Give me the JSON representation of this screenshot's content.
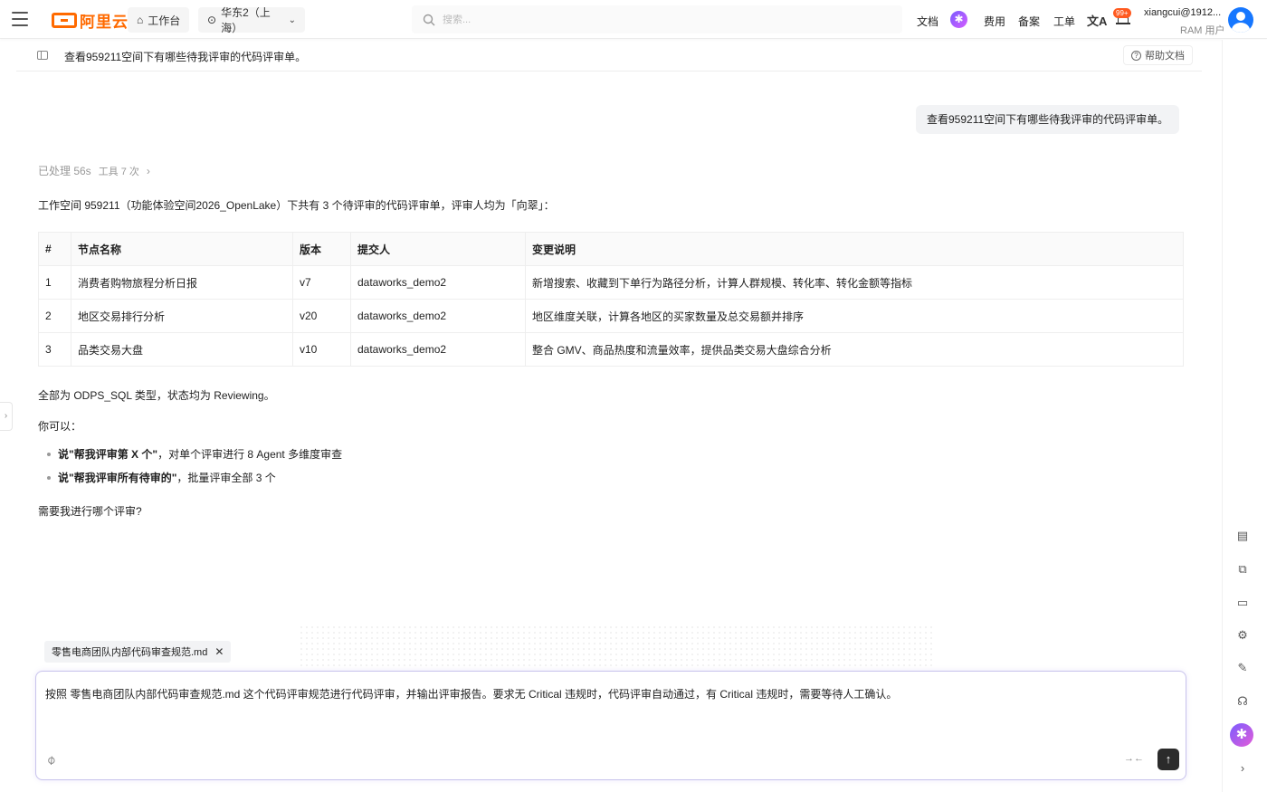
{
  "topbar": {
    "logo_text": "阿里云",
    "workbench": "工作台",
    "region": "华东2（上海）",
    "search_placeholder": "搜索...",
    "links": {
      "docs": "文档",
      "billing": "费用",
      "icp": "备案",
      "tickets": "工单"
    },
    "notification_badge": "99+",
    "user_name": "xiangcui@1912...",
    "user_role": "RAM 用户",
    "accent_color": "#ff6a00"
  },
  "subheader": {
    "title": "查看959211空间下有哪些待我评审的代码评审单。",
    "help": "帮助文档"
  },
  "chat": {
    "user_message": "查看959211空间下有哪些待我评审的代码评审单。",
    "processed": "已处理 56s",
    "tools": "工具 7 次",
    "summary": "工作空间 959211（功能体验空间2026_OpenLake）下共有 3 个待评审的代码评审单，评审人均为「向翠」：",
    "table": {
      "headers": [
        "#",
        "节点名称",
        "版本",
        "提交人",
        "变更说明"
      ],
      "rows": [
        [
          "1",
          "消费者购物旅程分析日报",
          "v7",
          "dataworks_demo2",
          "新增搜索、收藏到下单行为路径分析，计算人群规模、转化率、转化金额等指标"
        ],
        [
          "2",
          "地区交易排行分析",
          "v20",
          "dataworks_demo2",
          "地区维度关联，计算各地区的买家数量及总交易额并排序"
        ],
        [
          "3",
          "品类交易大盘",
          "v10",
          "dataworks_demo2",
          "整合 GMV、商品热度和流量效率，提供品类交易大盘综合分析"
        ]
      ]
    },
    "type_status": "全部为 ODPS_SQL 类型，状态均为 Reviewing。",
    "you_can": "你可以：",
    "options": [
      {
        "bold": "说\"帮我评审第 X 个\"",
        "rest": "，对单个评审进行 8 Agent 多维度审查"
      },
      {
        "bold": "说\"帮我评审所有待审的\"",
        "rest": "，批量评审全部 3 个"
      }
    ],
    "question": "需要我进行哪个评审?"
  },
  "composer": {
    "attachment": "零售电商团队内部代码审查规范.md",
    "text": "按照 零售电商团队内部代码审查规范.md 这个代码评审规范进行代码评审，并输出评审报告。要求无 Critical 违规时，代码评审自动通过，有 Critical 违规时，需要等待人工确认。"
  }
}
